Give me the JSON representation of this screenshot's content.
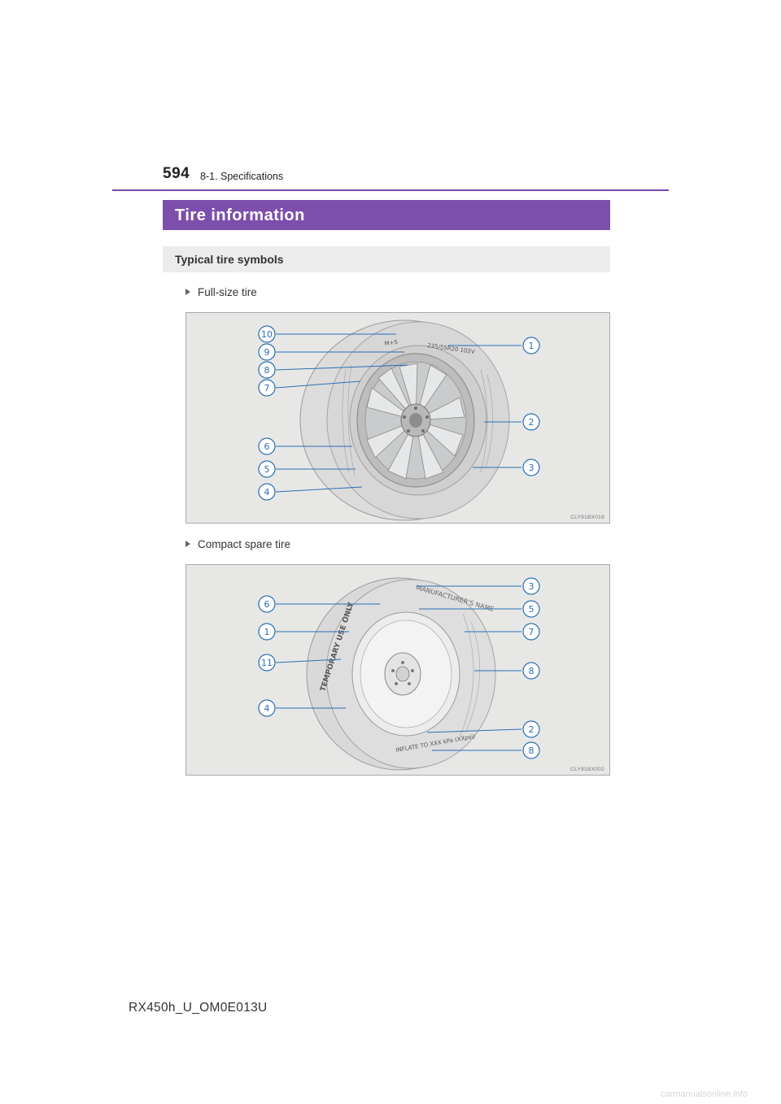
{
  "header": {
    "page_number": "594",
    "section_ref": "8-1. Specifications"
  },
  "section": {
    "title": "Tire information"
  },
  "subsection": {
    "title": "Typical tire symbols"
  },
  "figures": [
    {
      "bullet": "Full-size tire",
      "code": "CLY91BX018",
      "left_callouts": [
        "10",
        "9",
        "8",
        "7",
        "6",
        "5",
        "4"
      ],
      "right_callouts": [
        "1",
        "2",
        "3"
      ],
      "sidewall_text": [
        "M+S",
        "235/55R20 102V"
      ]
    },
    {
      "bullet": "Compact spare tire",
      "code": "CLY91BX002",
      "left_callouts": [
        "6",
        "1",
        "11",
        "4"
      ],
      "right_callouts": [
        "3",
        "5",
        "7",
        "8",
        "2",
        "8"
      ],
      "sidewall_text": [
        "TEMPORARY USE ONLY",
        "MANUFACTURER'S NAME",
        "INFLATE TO XXX kPa (XXpsi)"
      ]
    }
  ],
  "footer": {
    "manual_code": "RX450h_U_OM0E013U",
    "watermark": "carmanualsonline.info"
  }
}
